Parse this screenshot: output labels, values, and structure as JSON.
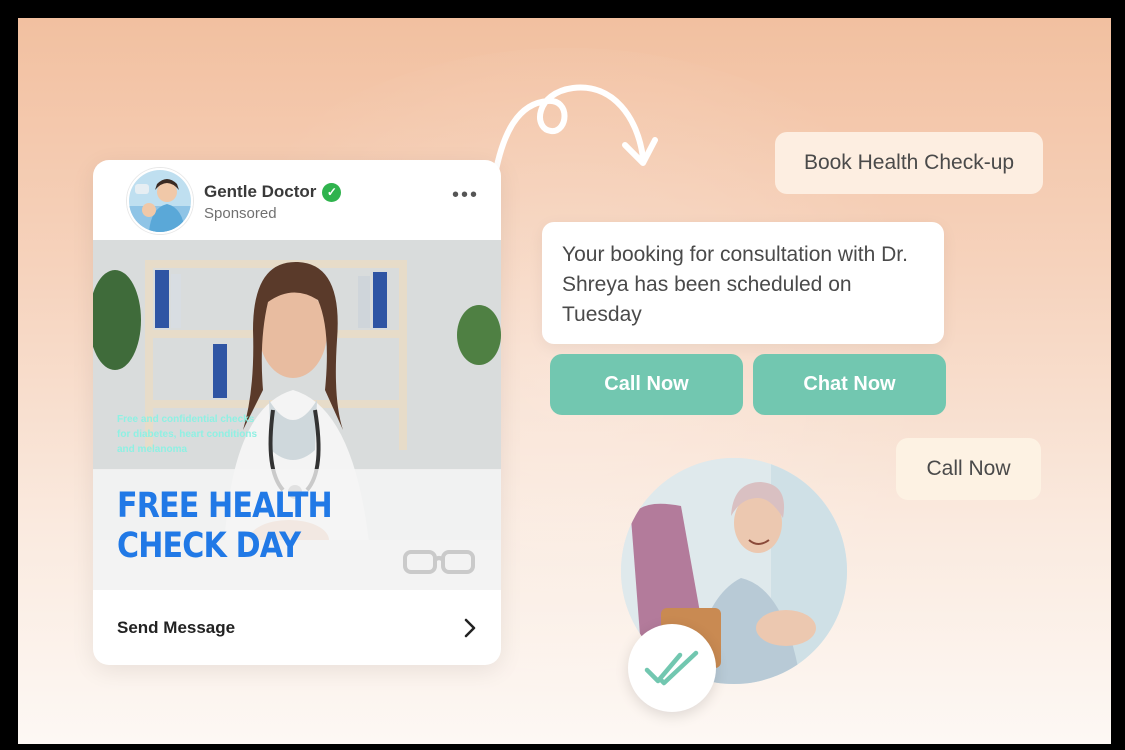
{
  "ad": {
    "page_name": "Gentle Doctor",
    "sponsored": "Sponsored",
    "tagline": "Free and confidential checks for diabetes, heart conditions and melanoma",
    "headline_line1": "FREE HEALTH",
    "headline_line2": "CHECK DAY",
    "cta": "Send Message",
    "icons": [
      "verified-badge-icon",
      "more-options-icon",
      "chevron-right-icon"
    ]
  },
  "chat": {
    "quick_reply": "Book Health Check-up",
    "message": "Your booking for consultation with Dr. Shreya has been scheduled on Tuesday",
    "buttons": [
      "Call Now",
      "Chat Now"
    ],
    "user_reply": "Call Now"
  },
  "colors": {
    "accent_teal": "#72c7b0",
    "headline_blue": "#2179e6",
    "verified_green": "#2fb34d",
    "bg_peach": "#f2c0a0"
  },
  "status_icon": "double-check-icon"
}
